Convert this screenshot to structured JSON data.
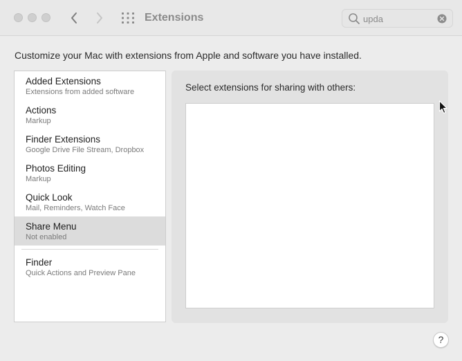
{
  "window": {
    "title": "Extensions"
  },
  "search": {
    "value": "upda",
    "placeholder": "Search"
  },
  "intro_text": "Customize your Mac with extensions from Apple and software you have installed.",
  "sidebar": {
    "items": [
      {
        "title": "Added Extensions",
        "subtitle": "Extensions from added software",
        "selected": false
      },
      {
        "title": "Actions",
        "subtitle": "Markup",
        "selected": false
      },
      {
        "title": "Finder Extensions",
        "subtitle": "Google Drive File Stream, Dropbox",
        "selected": false
      },
      {
        "title": "Photos Editing",
        "subtitle": "Markup",
        "selected": false
      },
      {
        "title": "Quick Look",
        "subtitle": "Mail, Reminders, Watch Face",
        "selected": false
      },
      {
        "title": "Share Menu",
        "subtitle": "Not enabled",
        "selected": true
      },
      {
        "title": "Finder",
        "subtitle": "Quick Actions and Preview Pane",
        "selected": false
      }
    ]
  },
  "panel": {
    "heading": "Select extensions for sharing with others:"
  },
  "help": {
    "label": "?"
  },
  "colors": {
    "window_bg": "#ececec",
    "selected_row": "#dcdcdc",
    "panel_bg": "#e2e2e2"
  },
  "icons": {
    "back": "chevron-left-icon",
    "forward": "chevron-right-icon",
    "grid": "grid-icon",
    "search": "search-icon",
    "clear": "clear-icon",
    "cursor": "mouse-pointer-icon"
  }
}
